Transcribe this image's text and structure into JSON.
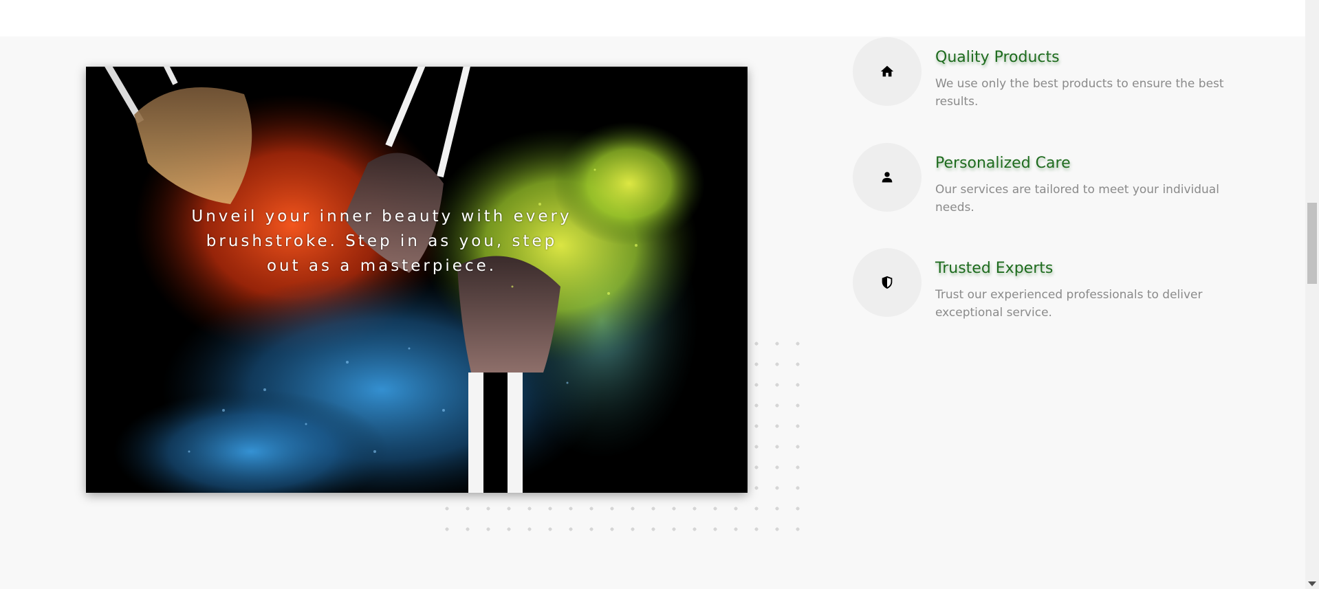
{
  "hero": {
    "caption": "Unveil your inner beauty with every brushstroke. Step in as you, step out as a masterpiece."
  },
  "features": [
    {
      "title": "Quality Products",
      "description": "We use only the best products to ensure the best results.",
      "icon": "home-icon"
    },
    {
      "title": "Personalized Care",
      "description": "Our services are tailored to meet your individual needs.",
      "icon": "person-icon"
    },
    {
      "title": "Trusted Experts",
      "description": "Trust our experienced professionals to deliver exceptional service.",
      "icon": "shield-icon"
    }
  ],
  "colors": {
    "title_green": "#1e6b1e",
    "description_gray": "#8a8a8a",
    "icon_circle": "#eeeeee"
  }
}
